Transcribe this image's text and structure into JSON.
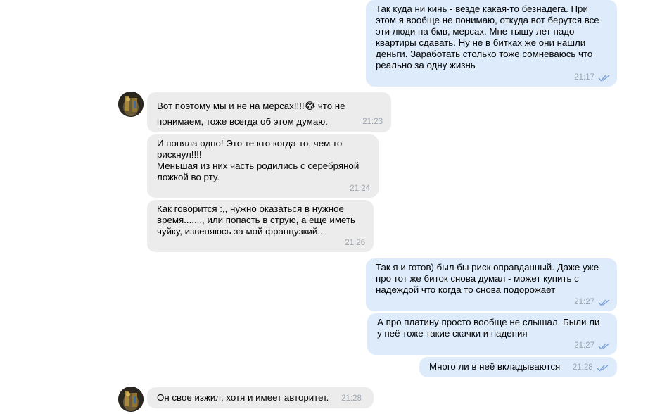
{
  "messages": [
    {
      "text": "Так куда ни кинь - везде какая-то безнадега. При\nэтом я вообще не понимаю, откуда вот берутся все\nэти люди на бмв, мерсах. Мне тыщу лет надо\nквартиры сдавать. Ну не в битках же они нашли\nденьги. Заработать столько тоже сомневаюсь что\nреально за одну жизнь",
      "time": "21:17",
      "read": true
    },
    {
      "text": "Вот поэтому мы и не на мерсах!!!!😂 что не\nпонимаем, тоже всегда об этом думаю.",
      "time": "21:23"
    },
    {
      "text": "И поняла одно! Это те кто когда-то, чем то\nрискнул!!!!\nМеньшая из них часть родились с серебряной\nложкой во рту.",
      "time": "21:24"
    },
    {
      "text": "Как говорится :,, нужно оказаться в нужное\nвремя......., или попасть в струю, а еще иметь\nчуйку, извеняюсь за мой французкий...",
      "time": "21:26"
    },
    {
      "text": "Так я и готов) был бы риск оправданный. Даже уже\nпро тот же биток снова думал - может купить с\nнадеждой что когда то снова подорожает",
      "time": "21:27",
      "read": true
    },
    {
      "text": "А про платину просто вообще не слышал. Были ли\nу неё тоже такие скачки и падения",
      "time": "21:27",
      "read": true
    },
    {
      "text": "Много ли в неё вкладываются",
      "time": "21:28",
      "read": true
    },
    {
      "text": "Он свое изжил, хотя и имеет авторитет.",
      "time": "21:28"
    }
  ],
  "colors": {
    "outgoing_bubble": "#ddebfb",
    "incoming_bubble": "#ececec",
    "read_ticks": "#7a9fd6",
    "time_text": "#9aa3ad"
  },
  "icons": {
    "read_status": "double-check-icon"
  }
}
